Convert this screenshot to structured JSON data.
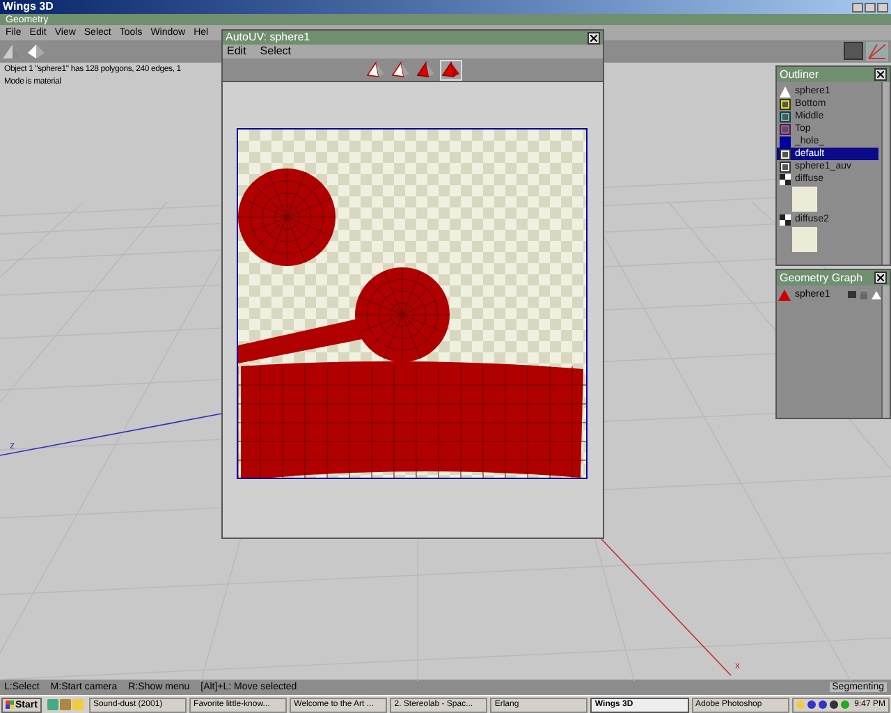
{
  "window": {
    "title": "Wings 3D"
  },
  "geometry_bar": {
    "title": "Geometry"
  },
  "menu": [
    "File",
    "Edit",
    "View",
    "Select",
    "Tools",
    "Window",
    "Hel"
  ],
  "axis_labels": [
    "z",
    "x"
  ],
  "info_lines": [
    "Object 1 \"sphere1\" has 128 polygons, 240 edges, 1",
    "Mode is material"
  ],
  "autouv": {
    "title": "AutoUV: sphere1",
    "menu": [
      "Edit",
      "Select"
    ],
    "modes": [
      {
        "kind": "vertex",
        "selected": false
      },
      {
        "kind": "edge",
        "selected": false
      },
      {
        "kind": "face",
        "selected": false
      },
      {
        "kind": "body",
        "selected": true
      }
    ]
  },
  "outliner": {
    "title": "Outliner",
    "items": [
      {
        "label": "sphere1",
        "kind": "object",
        "selected": false
      },
      {
        "label": "Bottom",
        "kind": "material",
        "color": "#e0e000",
        "selected": false
      },
      {
        "label": "Middle",
        "kind": "material",
        "color": "#40c8c8",
        "selected": false
      },
      {
        "label": "Top",
        "kind": "material",
        "color": "#c040c0",
        "selected": false
      },
      {
        "label": "_hole_",
        "kind": "swatch",
        "color": "#0000a0",
        "selected": false
      },
      {
        "label": "default",
        "kind": "material",
        "color": "#f0f0f0",
        "selected": true
      },
      {
        "label": "sphere1_auv",
        "kind": "material",
        "color": "#f0f0f0",
        "selected": false
      },
      {
        "label": "diffuse",
        "kind": "image",
        "selected": false
      },
      {
        "label": "diffuse2",
        "kind": "image",
        "selected": false
      }
    ]
  },
  "geometry_graph": {
    "title": "Geometry Graph",
    "items": [
      {
        "label": "sphere1"
      }
    ]
  },
  "status_bar": {
    "hints": [
      "L:Select",
      "M:Start camera",
      "R:Show menu",
      "[Alt]+L: Move selected"
    ],
    "mode": "Segmenting"
  },
  "taskbar": {
    "start": "Start",
    "items": [
      {
        "label": "Sound-dust (2001)",
        "selected": false
      },
      {
        "label": "Favorite little-know...",
        "selected": false
      },
      {
        "label": "Welcome to the Art ...",
        "selected": false
      },
      {
        "label": "2. Stereolab - Spac...",
        "selected": false
      },
      {
        "label": "Erlang",
        "selected": false
      },
      {
        "label": "Wings 3D",
        "selected": true
      },
      {
        "label": "Adobe Photoshop",
        "selected": false
      }
    ],
    "clock": "9:47 PM"
  }
}
